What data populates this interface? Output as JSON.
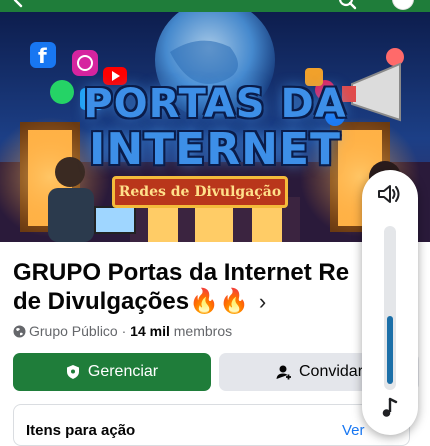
{
  "top_bar": {
    "back_icon": "arrow-left-icon",
    "search_icon": "search-icon",
    "profile_icon": "avatar-icon"
  },
  "cover": {
    "title_line1": "PORTAS DA",
    "title_line2": "INTERNET",
    "ribbon": "Redes de Divulgação"
  },
  "group": {
    "title_line1": "GRUPO Portas da Internet Re",
    "title_line2": "de Divulgações🔥🔥",
    "chevron": "›",
    "privacy": "Grupo Público",
    "separator": "·",
    "member_count": "14 mil",
    "members_label": "membros"
  },
  "actions": {
    "manage_label": "Gerenciar",
    "manage_icon": "shield-icon",
    "invite_label": "Convidar",
    "invite_icon": "add-person-icon"
  },
  "card": {
    "title": "Itens para ação",
    "link": "Ver"
  },
  "volume": {
    "speaker_icon": "speaker-icon",
    "level": 0.45,
    "music_icon": "music-note-icon"
  },
  "colors": {
    "brand_green": "#1f7d3a",
    "volume_fill": "#1b6fa8",
    "link_blue": "#1877f2"
  }
}
